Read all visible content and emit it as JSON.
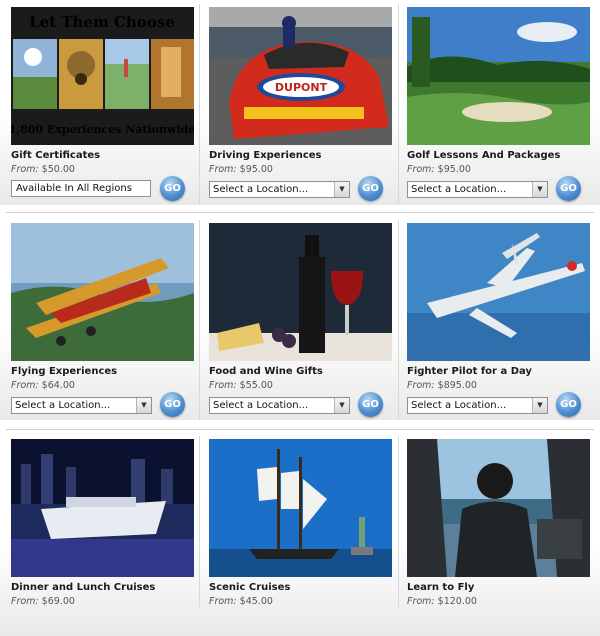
{
  "cards": [
    {
      "title": "Gift Certificates",
      "from_label": "From:",
      "price": "$50.00",
      "control": "Available In All Regions",
      "go": "GO",
      "banner": {
        "headline": "Let Them Choose",
        "footer": "1,800 Experiences Nationwide"
      }
    },
    {
      "title": "Driving Experiences",
      "from_label": "From:",
      "price": "$95.00",
      "control": "Select a Location...",
      "go": "GO"
    },
    {
      "title": "Golf Lessons And Packages",
      "from_label": "From:",
      "price": "$95.00",
      "control": "Select a Location...",
      "go": "GO"
    },
    {
      "title": "Flying Experiences",
      "from_label": "From:",
      "price": "$64.00",
      "control": "Select a Location...",
      "go": "GO"
    },
    {
      "title": "Food and Wine Gifts",
      "from_label": "From:",
      "price": "$55.00",
      "control": "Select a Location...",
      "go": "GO"
    },
    {
      "title": "Fighter Pilot for a Day",
      "from_label": "From:",
      "price": "$895.00",
      "control": "Select a Location...",
      "go": "GO"
    },
    {
      "title": "Dinner and Lunch Cruises",
      "from_label": "From:",
      "price": "$69.00"
    },
    {
      "title": "Scenic Cruises",
      "from_label": "From:",
      "price": "$45.00"
    },
    {
      "title": "Learn to Fly",
      "from_label": "From:",
      "price": "$120.00"
    }
  ],
  "colors": {
    "go_button": "#3f82c8",
    "divider": "#cfcfcf"
  }
}
